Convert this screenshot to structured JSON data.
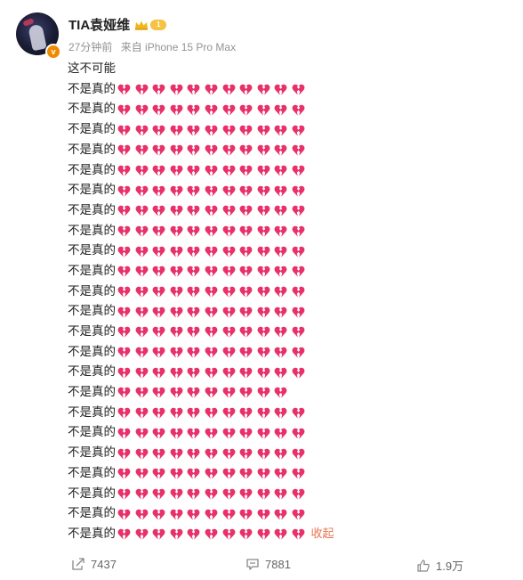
{
  "post": {
    "author": "TIA袁娅维",
    "badge_level": "1",
    "time": "27分钟前",
    "source": "来自 iPhone 15 Pro Max",
    "first_line": "这不可能",
    "repeat_text": "不是真的",
    "heart_emoji": "broken-heart",
    "heart_color": "#e8316a",
    "heart_counts": [
      11,
      11,
      11,
      11,
      11,
      11,
      11,
      11,
      11,
      11,
      11,
      11,
      11,
      11,
      11,
      10,
      11,
      11,
      11,
      11,
      11,
      11,
      11
    ],
    "collapse_label": "收起"
  },
  "footer": {
    "share_count": "7437",
    "comment_count": "7881",
    "like_count": "1.9万"
  },
  "icons": [
    "share-icon",
    "comment-icon",
    "like-icon",
    "crown-icon",
    "verified-badge-icon"
  ]
}
